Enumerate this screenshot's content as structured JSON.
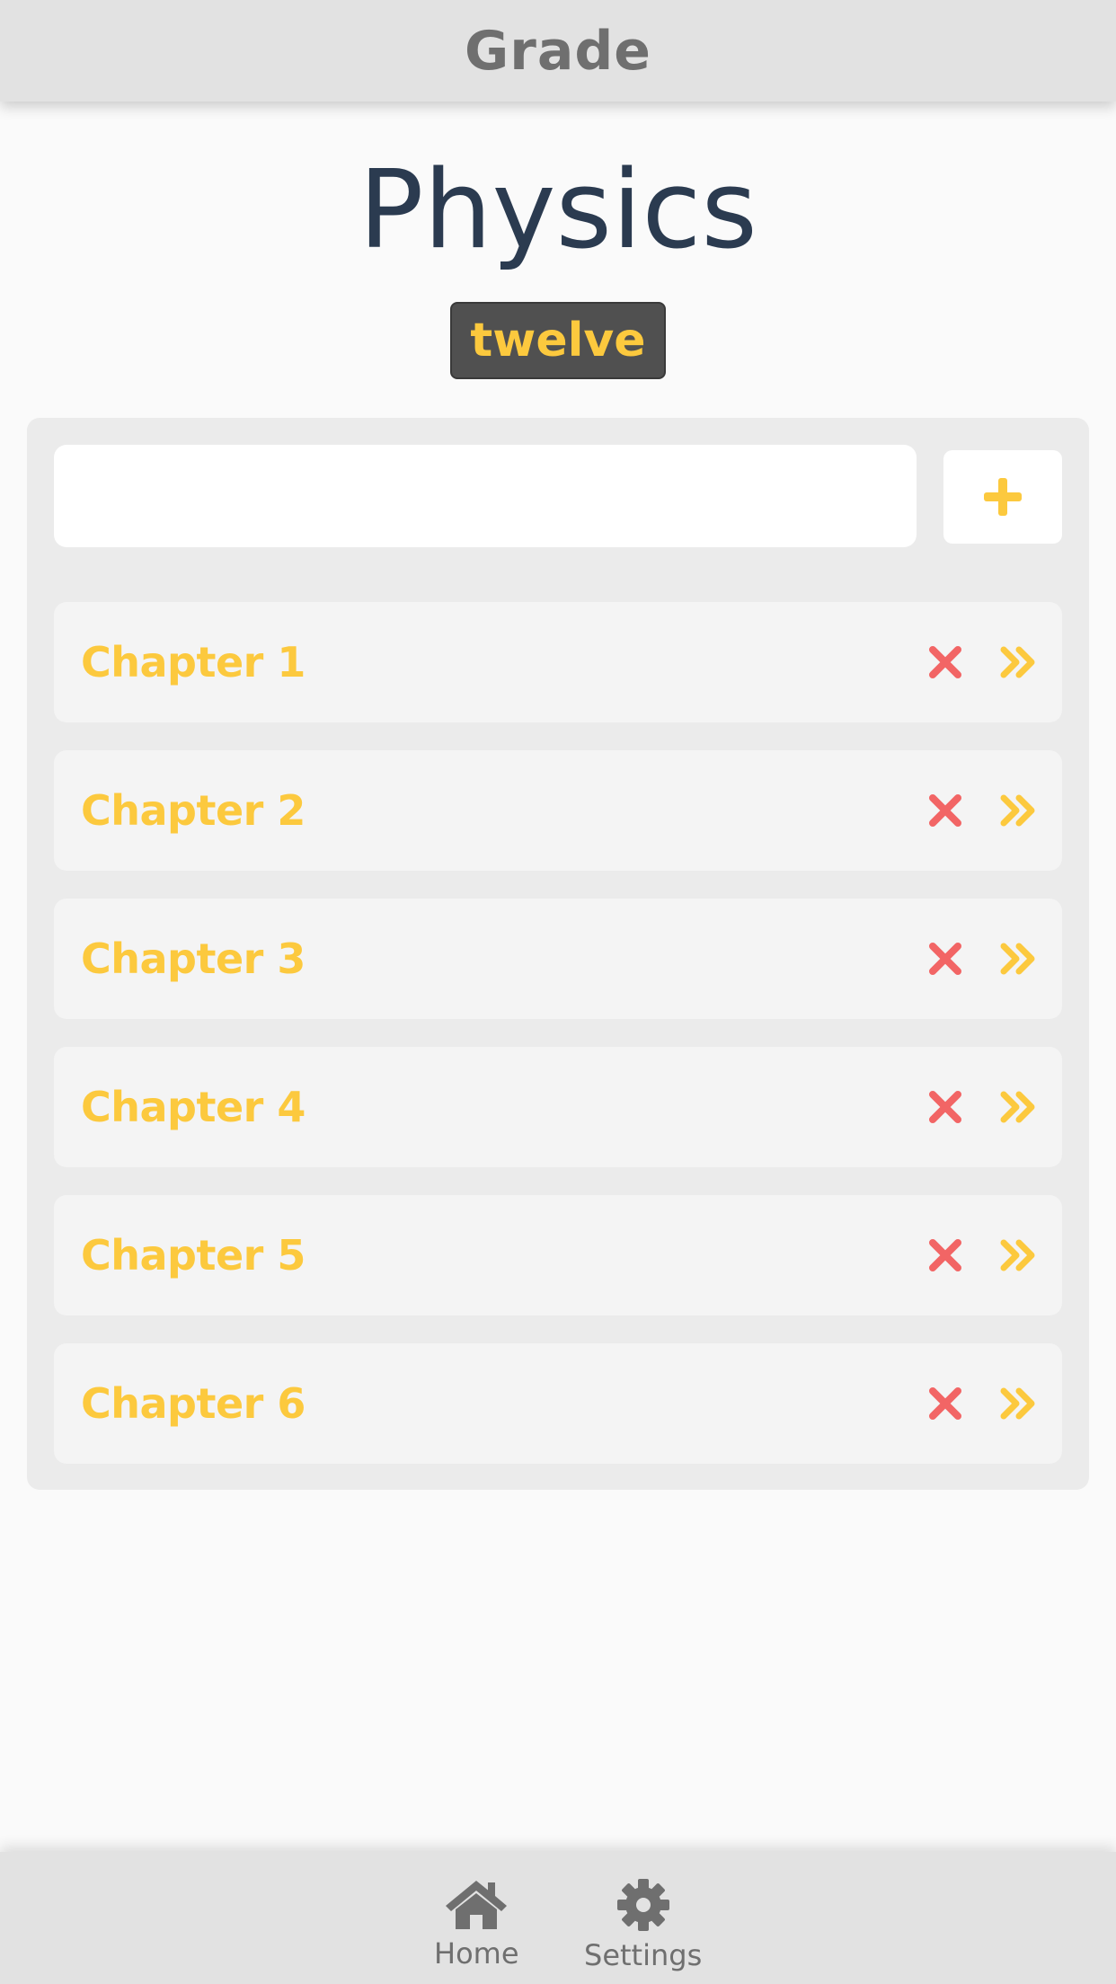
{
  "header": {
    "title": "Grade"
  },
  "subject": {
    "title": "Physics",
    "grade": "twelve"
  },
  "chapter_form": {
    "input_value": "",
    "input_placeholder": "",
    "add_icon": "plus-icon"
  },
  "chapters": [
    {
      "label": "Chapter 1"
    },
    {
      "label": "Chapter 2"
    },
    {
      "label": "Chapter 3"
    },
    {
      "label": "Chapter 4"
    },
    {
      "label": "Chapter 5"
    },
    {
      "label": "Chapter 6"
    }
  ],
  "row_icons": {
    "delete": "close-icon",
    "open": "double-chevron-right-icon"
  },
  "bottom_nav": {
    "items": [
      {
        "label": "Home",
        "icon": "home-icon"
      },
      {
        "label": "Settings",
        "icon": "gear-icon"
      }
    ]
  },
  "colors": {
    "accent_yellow": "#fcc93e",
    "delete_red": "#f26565",
    "title_navy": "#2b3b50",
    "bar_gray": "#e2e2e2",
    "icon_gray": "#6f6f6f"
  }
}
